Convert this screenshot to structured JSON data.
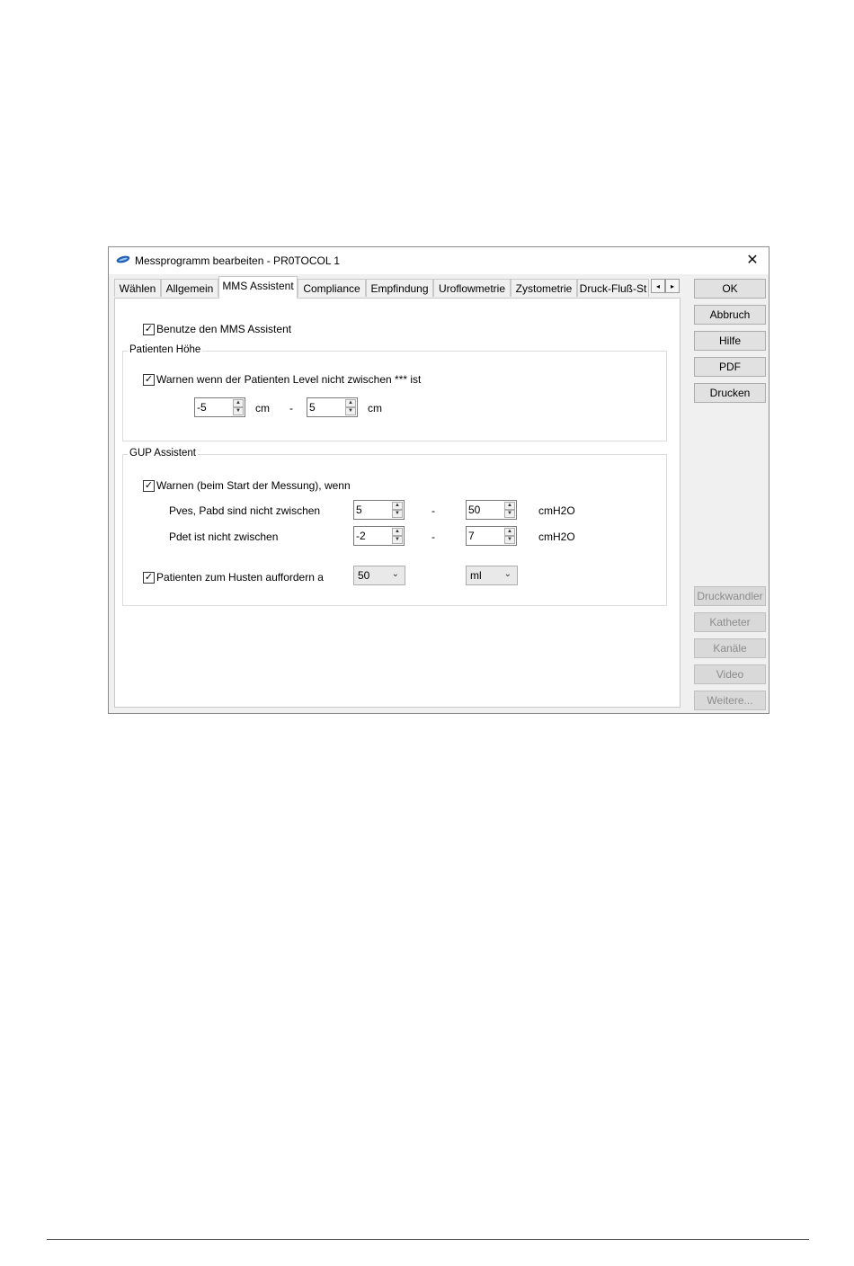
{
  "window": {
    "title": "Messprogramm bearbeiten - PR0TOCOL 1",
    "close_glyph": "✕",
    "icon": "app-logo-icon"
  },
  "tabs": [
    "Wählen",
    "Allgemein",
    "MMS Assistent",
    "Compliance",
    "Empfindung",
    "Uroflowmetrie",
    "Zystometrie",
    "Druck-Fluß-St"
  ],
  "active_tab": "MMS Assistent",
  "tab_scroll": {
    "left": "◂",
    "right": "▸"
  },
  "mms": {
    "use_assistant": {
      "label": "Benutze den MMS Assistent",
      "checked": true
    },
    "patient_height": {
      "title": "Patienten Höhe",
      "warn": {
        "label": "Warnen wenn der Patienten Level nicht zwischen *** ist",
        "checked": true
      },
      "min": "-5",
      "min_unit": "cm",
      "dash": "-",
      "max": "5",
      "max_unit": "cm"
    },
    "gup": {
      "title": "GUP Assistent",
      "warn": {
        "label": "Warnen (beim Start der Messung), wenn",
        "checked": true
      },
      "row1": {
        "label": "Pves, Pabd sind nicht zwischen",
        "min": "5",
        "dash": "-",
        "max": "50",
        "unit": "cmH2O"
      },
      "row2": {
        "label": "Pdet ist nicht zwischen",
        "min": "-2",
        "dash": "-",
        "max": "7",
        "unit": "cmH2O"
      },
      "cough": {
        "label": "Patienten zum Husten auffordern a",
        "checked": true,
        "value": "50",
        "unit": "ml"
      }
    }
  },
  "buttons": {
    "ok": "OK",
    "abbruch": "Abbruch",
    "hilfe": "Hilfe",
    "pdf": "PDF",
    "drucken": "Drucken",
    "druckwandler": "Druckwandler",
    "katheter": "Katheter",
    "kanaele": "Kanäle",
    "video": "Video",
    "weitere": "Weitere..."
  },
  "colors": {
    "accent_logo": "#1f5fb4",
    "disabled_text": "#8c8c8c"
  }
}
